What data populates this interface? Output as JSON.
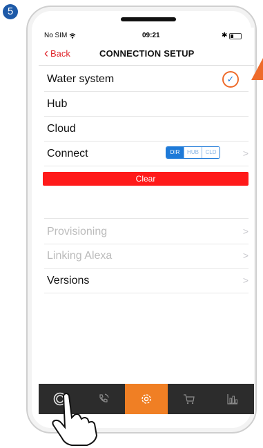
{
  "step": {
    "number": "5",
    "color": "#1e5aa8"
  },
  "status_bar": {
    "carrier": "No SIM",
    "time": "09:21",
    "bluetooth": "✱"
  },
  "nav": {
    "back": "Back",
    "title": "CONNECTION SETUP"
  },
  "rows": [
    {
      "label": "Water system",
      "accessory": "checkmark",
      "disabled": false
    },
    {
      "label": "Hub",
      "disabled": false
    },
    {
      "label": "Cloud",
      "disabled": false
    },
    {
      "label": "Connect",
      "disabled": false
    }
  ],
  "checkmark": "✓",
  "connect_segments": [
    "DIR",
    "HUB",
    "CLD"
  ],
  "clear_label": "Clear",
  "menu_rows": [
    {
      "label": "Provisioning",
      "disabled": true
    },
    {
      "label": "Linking Alexa",
      "disabled": true
    },
    {
      "label": "Versions",
      "disabled": false
    }
  ],
  "chevron": ">",
  "tabs": [
    {
      "icon": "touch-circle-icon",
      "active": false
    },
    {
      "icon": "phone-signal-icon",
      "active": false
    },
    {
      "icon": "gear-icon",
      "active": true
    },
    {
      "icon": "cart-icon",
      "active": false
    },
    {
      "icon": "bar-chart-icon",
      "active": false
    }
  ],
  "colors": {
    "accent": "#f07f24",
    "destructive": "#ff1a1a",
    "link": "#e0252b",
    "segment": "#1e7ad8"
  }
}
